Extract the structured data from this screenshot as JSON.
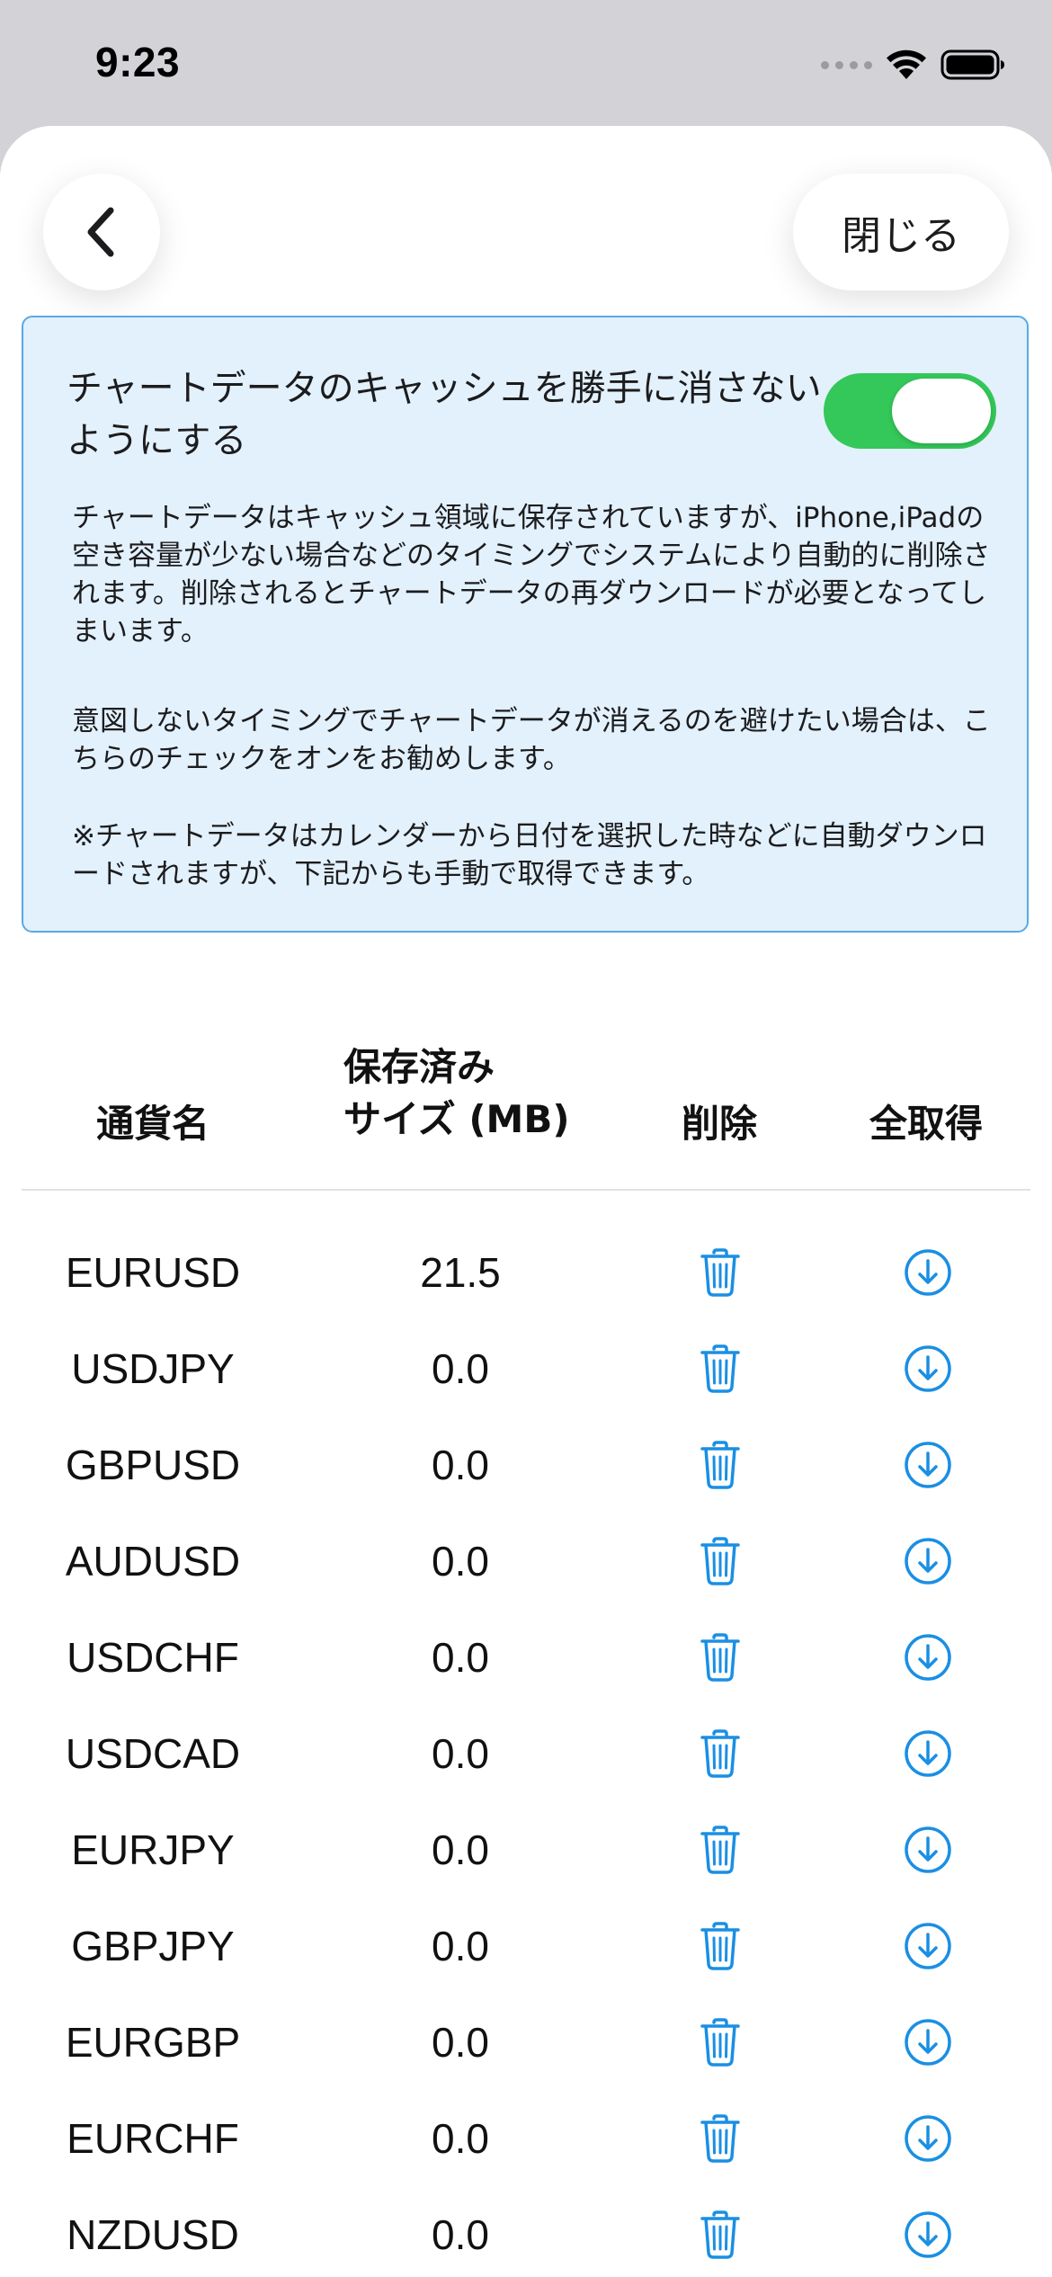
{
  "status_bar": {
    "time": "9:23"
  },
  "nav": {
    "back_icon": "chevron-left-icon",
    "close_label": "閉じる"
  },
  "info_card": {
    "toggle_label": "チャートデータのキャッシュを勝手に消さないようにする",
    "toggle_on": true,
    "description_1": "チャートデータはキャッシュ領域に保存されていますが、iPhone,iPadの空き容量が少ない場合などのタイミングでシステムにより自動的に削除されます。削除されるとチャートデータの再ダウンロードが必要となってしまいます。",
    "description_2": "意図しないタイミングでチャートデータが消えるのを避けたい場合は、こちらのチェックをオンをお勧めします。",
    "description_3": "※チャートデータはカレンダーから日付を選択した時などに自動ダウンロードされますが、下記からも手動で取得できます。"
  },
  "table": {
    "headers": {
      "name": "通貨名",
      "size_line1": "保存済み",
      "size_line2": "サイズ (MB)",
      "delete": "削除",
      "fetch_all": "全取得"
    },
    "rows": [
      {
        "name": "EURUSD",
        "size": "21.5"
      },
      {
        "name": "USDJPY",
        "size": "0.0"
      },
      {
        "name": "GBPUSD",
        "size": "0.0"
      },
      {
        "name": "AUDUSD",
        "size": "0.0"
      },
      {
        "name": "USDCHF",
        "size": "0.0"
      },
      {
        "name": "USDCAD",
        "size": "0.0"
      },
      {
        "name": "EURJPY",
        "size": "0.0"
      },
      {
        "name": "GBPJPY",
        "size": "0.0"
      },
      {
        "name": "EURGBP",
        "size": "0.0"
      },
      {
        "name": "EURCHF",
        "size": "0.0"
      },
      {
        "name": "NZDUSD",
        "size": "0.0"
      }
    ],
    "delete_icon": "trash-icon",
    "download_icon": "download-circle-icon"
  },
  "colors": {
    "accent": "#1a8fe3",
    "toggle_on": "#34c759",
    "card_background": "#e3f1fc",
    "card_border": "#5aa9e6"
  }
}
